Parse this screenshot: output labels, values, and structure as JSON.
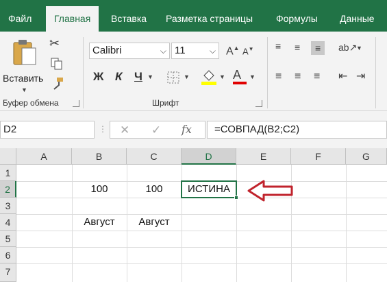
{
  "ribbon_tabs": [
    "Файл",
    "Главная",
    "Вставка",
    "Разметка страницы",
    "Формулы",
    "Данные"
  ],
  "clipboard": {
    "paste_label": "Вставить",
    "group_label": "Буфер обмена"
  },
  "font": {
    "name": "Calibri",
    "size": "11",
    "group_label": "Шрифт",
    "bold": "Ж",
    "italic": "К",
    "underline": "Ч",
    "grow": "A",
    "shrink": "A",
    "color_letter": "A"
  },
  "formula_bar": {
    "name_box": "D2",
    "formula": "=СОВПАД(B2;C2)",
    "fx": "fx"
  },
  "columns": [
    "A",
    "B",
    "C",
    "D",
    "E",
    "F",
    "G"
  ],
  "rows": [
    "1",
    "2",
    "3",
    "4",
    "5",
    "6",
    "7"
  ],
  "cells": {
    "B2": "100",
    "C2": "100",
    "D2": "ИСТИНА",
    "B4": "Август",
    "C4": "Август"
  },
  "colors": {
    "accent": "#217346",
    "arrow": "#c0232c",
    "highlight": "#ffff00",
    "font_color": "#e00000"
  }
}
